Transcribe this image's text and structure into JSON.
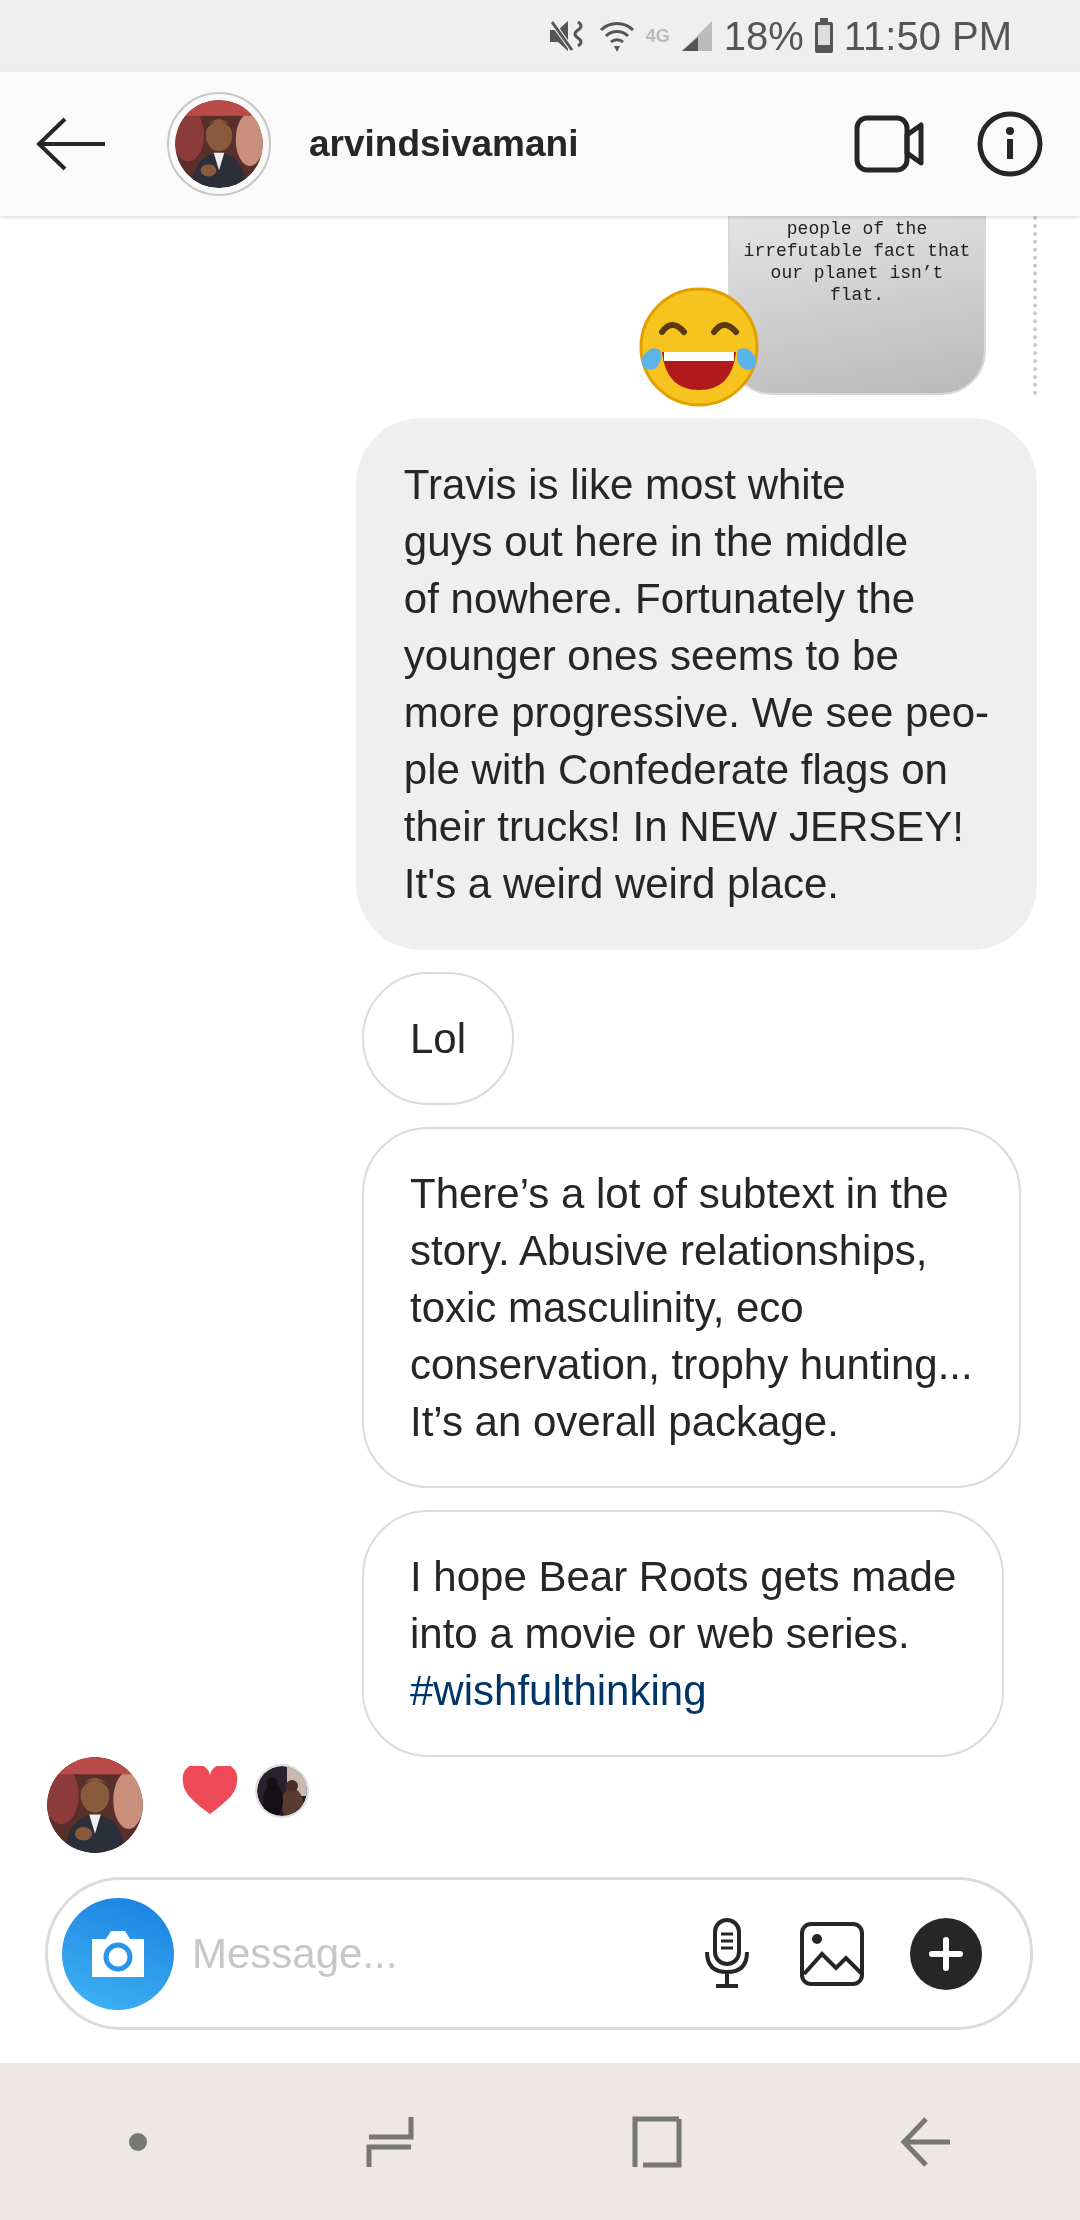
{
  "status_bar": {
    "network": "4G",
    "battery": "18%",
    "time": "11:50 PM"
  },
  "header": {
    "username": "arvindsivamani"
  },
  "story_reply": {
    "text": "people of the\nirrefutable fact that\nour planet isn’t\nflat."
  },
  "messages": [
    {
      "kind": "sent",
      "text": "Travis is like most white\nguys out here in the middle\nof nowhere. Fortunately the\nyounger ones seems to be\nmore progressive. We see peo-\nple with Confederate flags on\ntheir trucks! In NEW JERSEY!\nIt's a weird weird place."
    },
    {
      "kind": "received",
      "text": "Lol"
    },
    {
      "kind": "received",
      "text": "There’s a lot of subtext in the\nstory. Abusive relationships,\ntoxic masculinity, eco\nconservation, trophy hunting...\nIt’s an overall package."
    },
    {
      "kind": "received",
      "text": "I hope Bear Roots gets made\ninto a movie or web series.",
      "link": "#wishfulthinking"
    }
  ],
  "reaction": {
    "liked": true
  },
  "composer": {
    "placeholder": "Message..."
  }
}
